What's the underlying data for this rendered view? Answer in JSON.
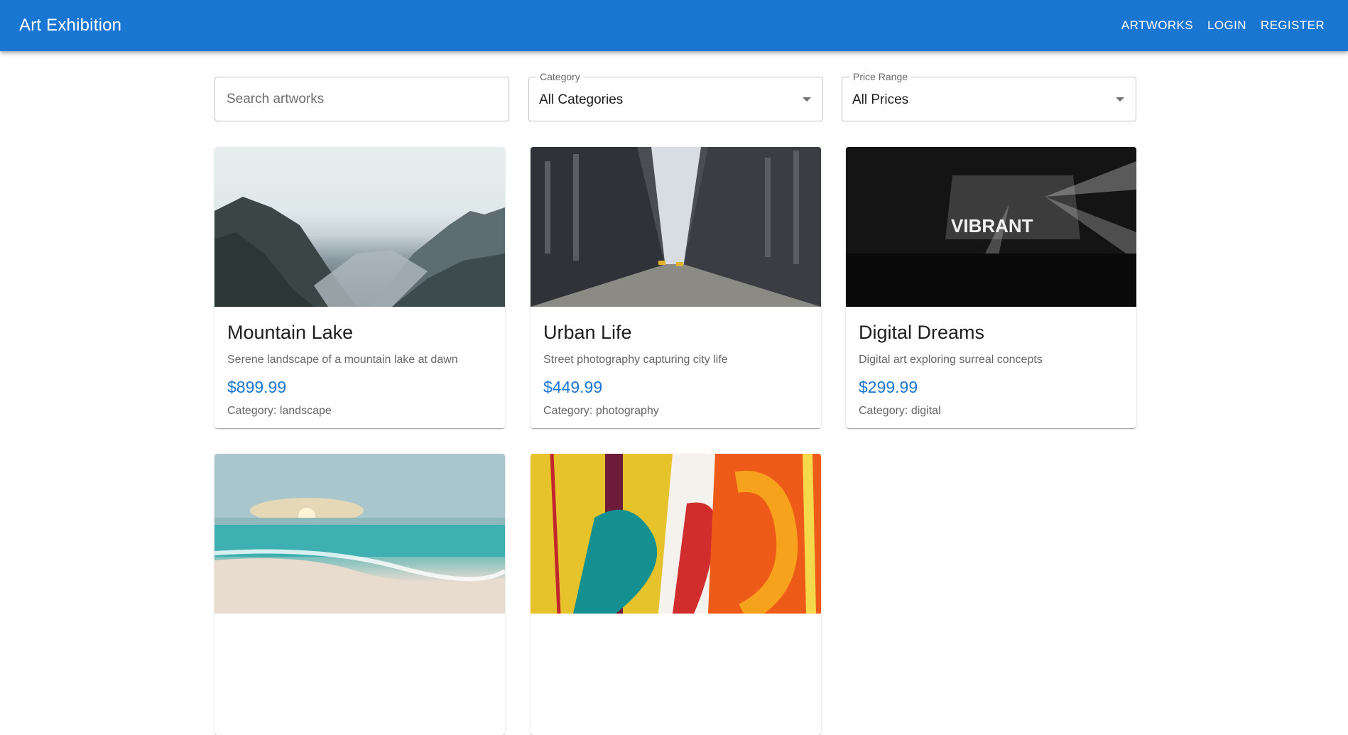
{
  "app": {
    "title": "Art Exhibition",
    "accent_color": "#1976d2"
  },
  "nav": {
    "items": [
      {
        "label": "Artworks"
      },
      {
        "label": "Login"
      },
      {
        "label": "Register"
      }
    ]
  },
  "filters": {
    "search": {
      "placeholder": "Search artworks",
      "value": ""
    },
    "category": {
      "label": "Category",
      "value": "All Categories"
    },
    "price": {
      "label": "Price Range",
      "value": "All Prices"
    }
  },
  "artworks": [
    {
      "title": "Mountain Lake",
      "description": "Serene landscape of a mountain lake at dawn",
      "price": "$899.99",
      "category": "Category: landscape",
      "image": "mountain-lake-photo"
    },
    {
      "title": "Urban Life",
      "description": "Street photography capturing city life",
      "price": "$449.99",
      "category": "Category: photography",
      "image": "city-street-photo"
    },
    {
      "title": "Digital Dreams",
      "description": "Digital art exploring surreal concepts",
      "price": "$299.99",
      "category": "Category: digital",
      "image": "concert-stage-photo"
    },
    {
      "image": "beach-sunset-photo"
    },
    {
      "image": "abstract-painting"
    }
  ]
}
